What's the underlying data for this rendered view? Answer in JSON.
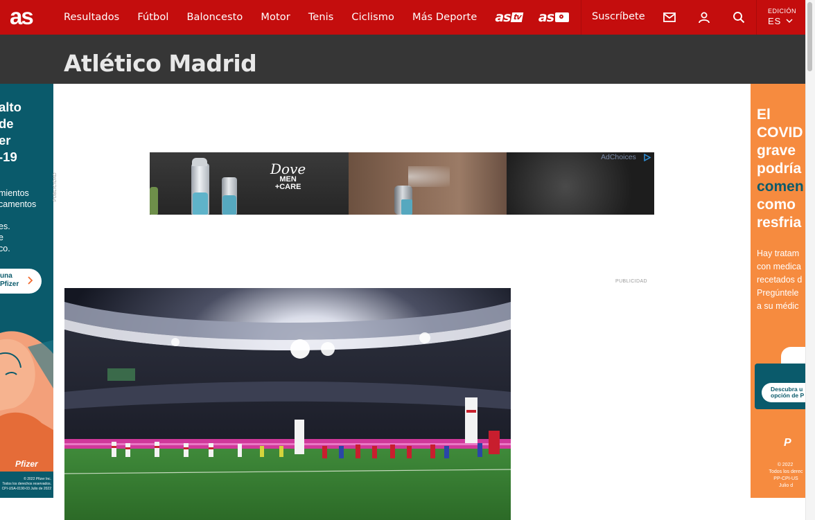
{
  "header": {
    "logo": "as",
    "nav": [
      "Resultados",
      "Fútbol",
      "Baloncesto",
      "Motor",
      "Tenis",
      "Ciclismo",
      "Más Deporte"
    ],
    "brand_tv": "as",
    "brand_tv_badge": "tv",
    "brand_photo": "as",
    "subscribe_label": "Suscríbete",
    "icons": [
      "mail-icon",
      "user-icon",
      "search-icon"
    ],
    "edition_label": "EDICIÓN",
    "edition_value": "ES",
    "brand_color": "#c40d0d"
  },
  "page": {
    "title": "Atlético Madrid",
    "title_band_color": "#363636"
  },
  "ads": {
    "left": {
      "headline": "alto\nde\ner\n-19",
      "body": "mientos\ncamentos\n\nes.\ne\nco.",
      "cta": "una\nPfizer",
      "brand": "Pfizer",
      "legal": "© 2022 Pfizer Inc.\nTodos los derechos reservados.\nCPI-USA-0190-03 Julio de 2022"
    },
    "right": {
      "headline_1": "El\nCOVID\ngrave\npodría\n",
      "headline_accent": "comen",
      "headline_2": "\ncomo\nresfria",
      "body": "Hay tratam\ncon medica\nrecetados d\nPregúntele\na su médic",
      "cta": "Descubra u\nopción de P",
      "legal": "© 2022 \nTodos los derec\nPP-CPI-US\nJulio d"
    },
    "banner": {
      "brand_line1": "Dove",
      "brand_line2": "MEN\n+CARE",
      "adchoices": "AdChoices",
      "publicidad_vertical": "PUBLICIDAD"
    },
    "publicidad_label": "PUBLICIDAD"
  }
}
